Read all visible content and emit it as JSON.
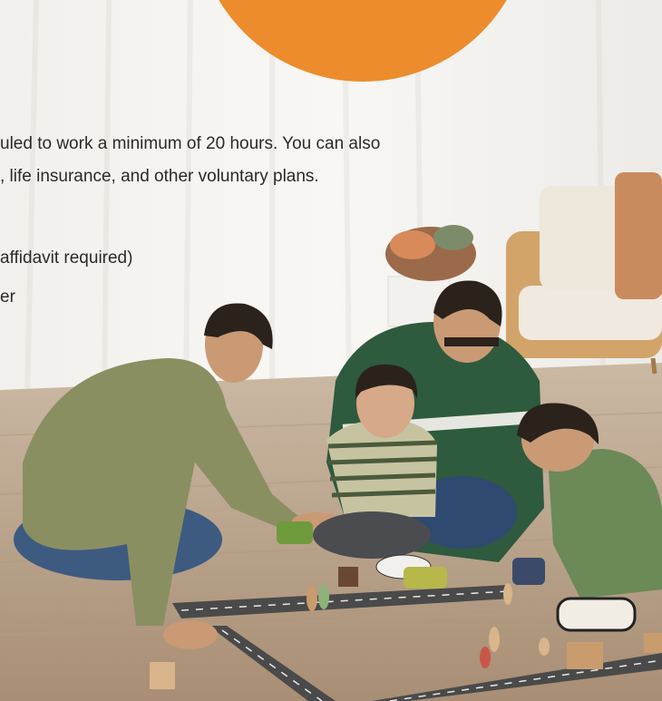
{
  "overlay": {
    "paragraph_line_1": "uled to work a minimum of 20 hours. You can also",
    "paragraph_line_2": ", life insurance, and other voluntary plans.",
    "list_line_1": "affidavit required)",
    "list_line_2": "er"
  },
  "decor": {
    "circle_color": "#ec8c2c",
    "background_color": "#f3f1ee"
  },
  "photo": {
    "subject": "family-playing-with-toys-on-floor"
  }
}
